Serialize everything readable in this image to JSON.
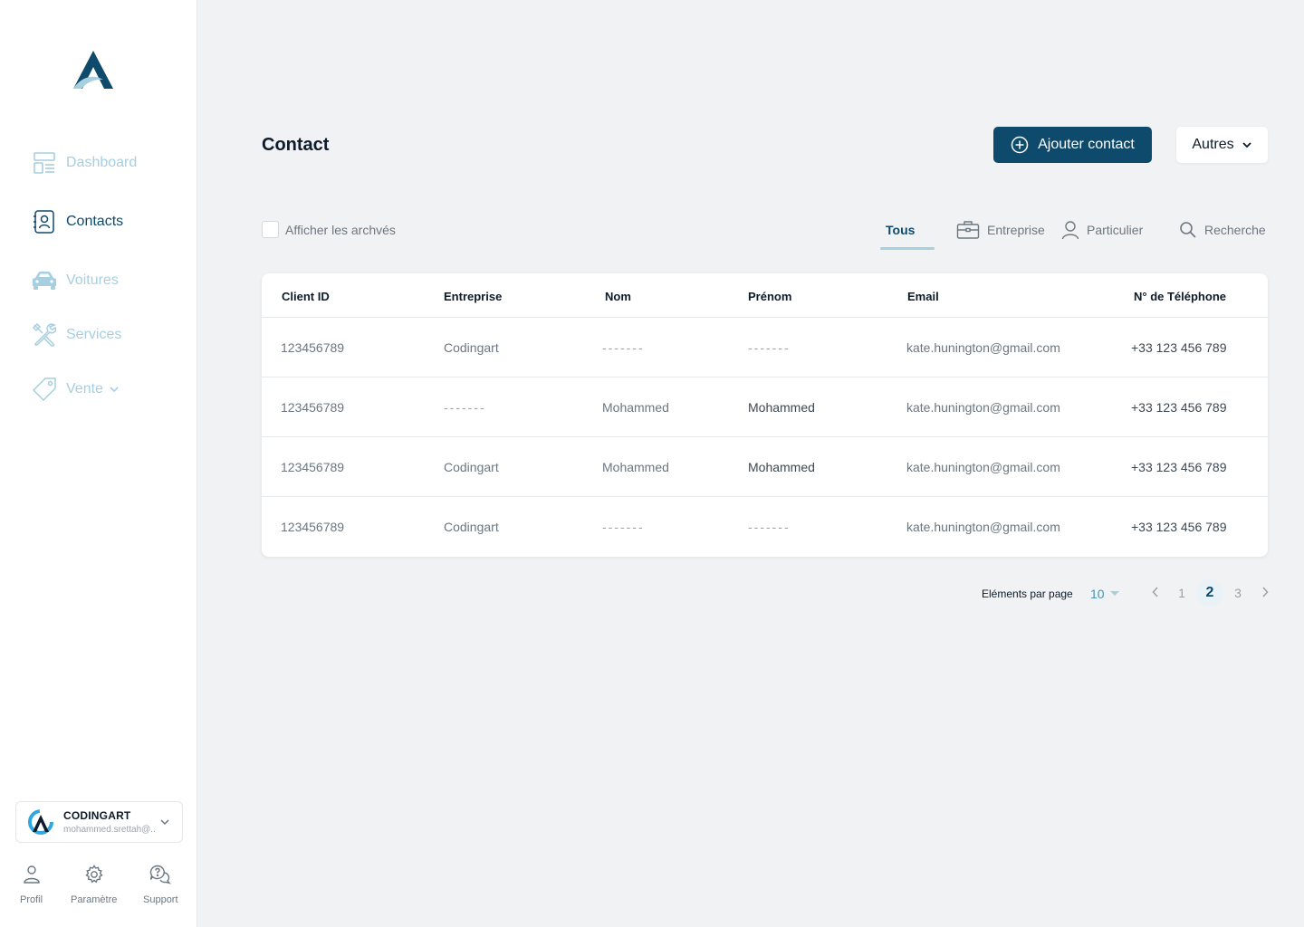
{
  "sidebar": {
    "nav": [
      {
        "label": "Dashboard",
        "icon": "dashboard-icon"
      },
      {
        "label": "Contacts",
        "icon": "contact-card-icon"
      },
      {
        "label": "Voitures",
        "icon": "car-icon"
      },
      {
        "label": "Services",
        "icon": "tools-icon"
      },
      {
        "label": "Vente",
        "icon": "tag-icon"
      }
    ],
    "account": {
      "name": "CODINGART",
      "email": "mohammed.srettah@..."
    },
    "bottom": [
      {
        "label": "Profil",
        "icon": "user-icon"
      },
      {
        "label": "Paramètre",
        "icon": "gear-icon"
      },
      {
        "label": "Support",
        "icon": "support-chat-icon"
      }
    ]
  },
  "header": {
    "title": "Contact",
    "add_button": "Ajouter contact",
    "others_button": "Autres"
  },
  "filters": {
    "archive_label": "Afficher les archvés",
    "tabs": [
      {
        "label": "Tous"
      },
      {
        "label": "Entreprise"
      },
      {
        "label": "Particulier"
      },
      {
        "label": "Recherche"
      }
    ]
  },
  "table": {
    "columns": [
      "Client ID",
      "Entreprise",
      "Nom",
      "Prénom",
      "Email",
      "N° de Téléphone"
    ],
    "rows": [
      [
        "123456789",
        "Codingart",
        "-------",
        "-------",
        "kate.hunington@gmail.com",
        "+33 123 456 789"
      ],
      [
        "123456789",
        "-------",
        "Mohammed",
        "Mohammed",
        "kate.hunington@gmail.com",
        "+33 123 456 789"
      ],
      [
        "123456789",
        "Codingart",
        "Mohammed",
        "Mohammed",
        "kate.hunington@gmail.com",
        "+33 123 456 789"
      ],
      [
        "123456789",
        "Codingart",
        "-------",
        "-------",
        "kate.hunington@gmail.com",
        "+33 123 456 789"
      ]
    ]
  },
  "pagination": {
    "per_page_label": "Eléments par page",
    "per_page_value": "10",
    "pages": [
      "1",
      "2",
      "3"
    ],
    "current": "2"
  },
  "colors": {
    "brand": "#0d4a6b",
    "accent_light": "#a6cfe0",
    "background": "#f0f2f4"
  }
}
